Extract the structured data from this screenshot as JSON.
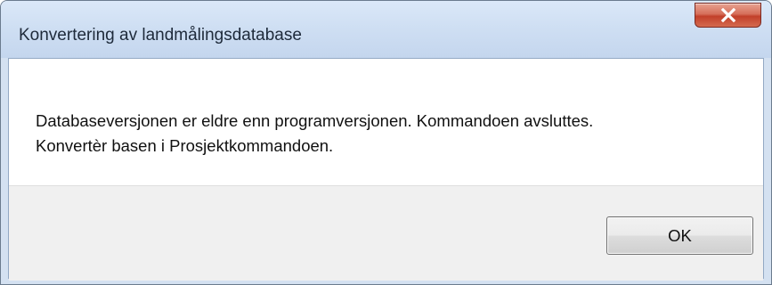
{
  "window": {
    "title": "Konvertering av landmålingsdatabase",
    "close_icon": "close-x-icon"
  },
  "dialog": {
    "message_lines": [
      "Databaseversjonen er eldre enn programversjonen. Kommandoen avsluttes.",
      "Konvertèr basen i Prosjektkommandoen."
    ],
    "ok_label": "OK"
  },
  "colors": {
    "titlebar": "#cfdff3",
    "close_button": "#c2402a",
    "button_area": "#f0f0f0"
  }
}
